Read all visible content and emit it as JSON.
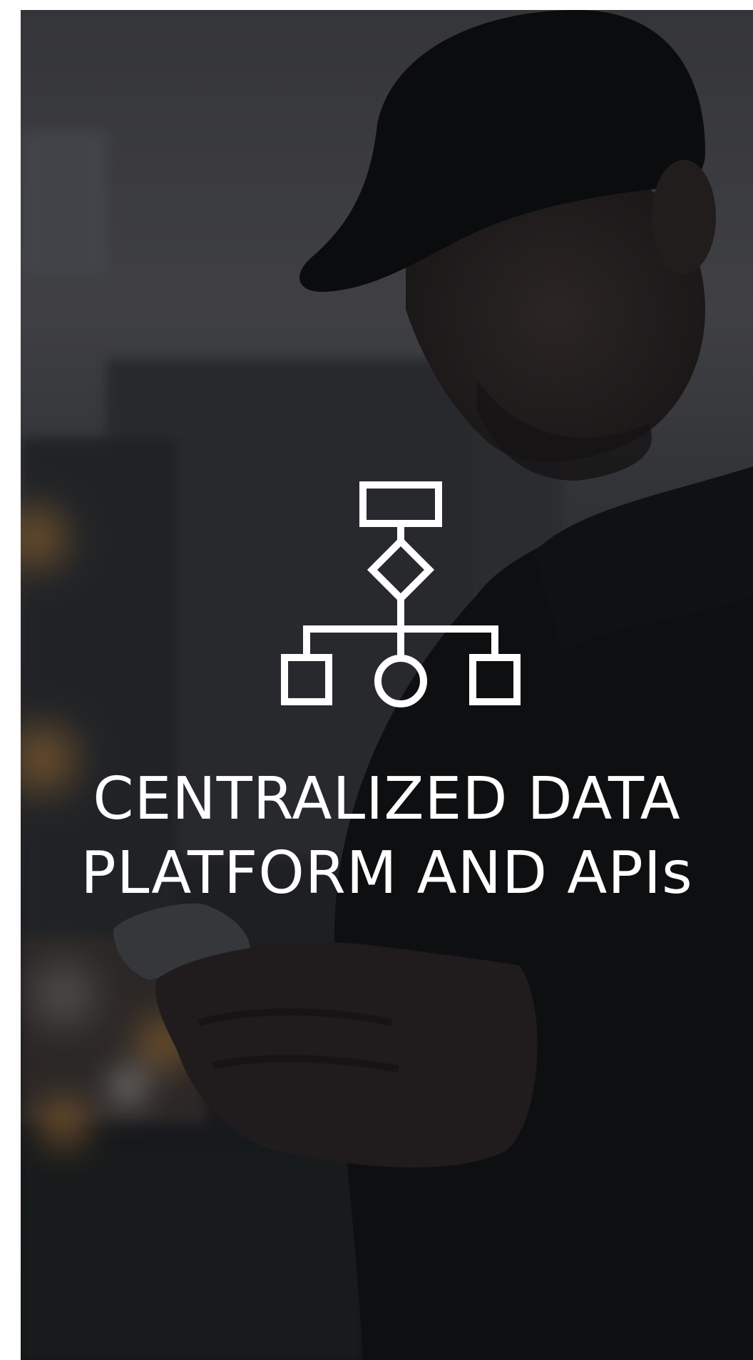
{
  "hero": {
    "icon": "hierarchy-flowchart-icon",
    "headline_line1": "CENTRALIZED DATA",
    "headline_line2": "PLATFORM AND APIs",
    "text_color": "#ffffff",
    "overlay_color": "#0d0e10"
  }
}
